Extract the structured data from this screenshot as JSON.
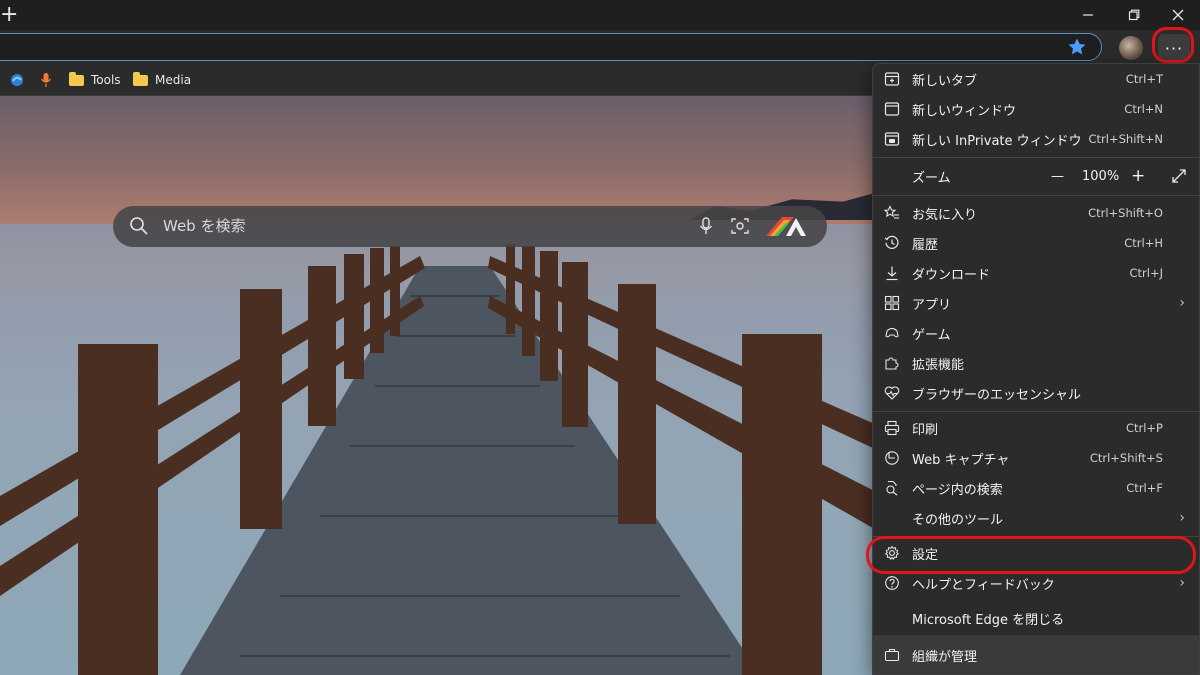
{
  "favorites": {
    "items": [
      {
        "label": "Tools"
      },
      {
        "label": "Media"
      }
    ]
  },
  "search": {
    "placeholder": "Web を検索"
  },
  "menu": {
    "new_tab": {
      "label": "新しいタブ",
      "shortcut": "Ctrl+T"
    },
    "new_window": {
      "label": "新しいウィンドウ",
      "shortcut": "Ctrl+N"
    },
    "new_inprivate": {
      "label": "新しい InPrivate ウィンドウ",
      "shortcut": "Ctrl+Shift+N"
    },
    "zoom": {
      "label": "ズーム",
      "minus": "—",
      "value": "100%",
      "plus": "+"
    },
    "favorites": {
      "label": "お気に入り",
      "shortcut": "Ctrl+Shift+O"
    },
    "history": {
      "label": "履歴",
      "shortcut": "Ctrl+H"
    },
    "downloads": {
      "label": "ダウンロード",
      "shortcut": "Ctrl+J"
    },
    "apps": {
      "label": "アプリ"
    },
    "games": {
      "label": "ゲーム"
    },
    "extensions": {
      "label": "拡張機能"
    },
    "essentials": {
      "label": "ブラウザーのエッセンシャル"
    },
    "print": {
      "label": "印刷",
      "shortcut": "Ctrl+P"
    },
    "web_capture": {
      "label": "Web キャプチャ",
      "shortcut": "Ctrl+Shift+S"
    },
    "find": {
      "label": "ページ内の検索",
      "shortcut": "Ctrl+F"
    },
    "more_tools": {
      "label": "その他のツール"
    },
    "settings": {
      "label": "設定"
    },
    "help": {
      "label": "ヘルプとフィードバック"
    },
    "close_edge": {
      "label": "Microsoft Edge を閉じる"
    },
    "managed": {
      "label": "組織が管理"
    }
  },
  "colors": {
    "highlight_ring": "#e0141b",
    "favorite_star": "#4a9eff",
    "menu_background": "#2b2b2b"
  }
}
